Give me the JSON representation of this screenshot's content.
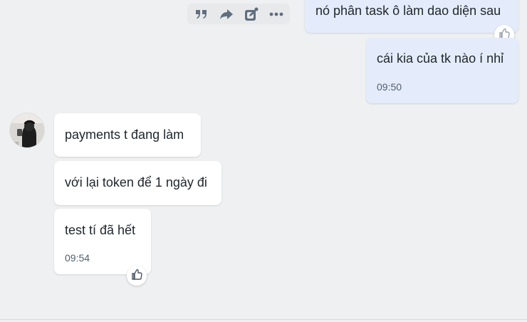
{
  "toolbar": {
    "icons": [
      "quote-icon",
      "forward-icon",
      "edit-icon",
      "more-icon"
    ],
    "icon_color": "#5f6f7f"
  },
  "messages": {
    "sent": [
      {
        "text": "nó phân task ô làm dao diện sau"
      },
      {
        "text": "cái kia của tk nào í nhỉ",
        "time": "09:50"
      }
    ],
    "received": [
      {
        "text": "payments t đang làm"
      },
      {
        "text": "với lại token để 1 ngày đi"
      },
      {
        "text": "test tí đã hết",
        "time": "09:54"
      }
    ]
  },
  "colors": {
    "background": "#eef0f1",
    "sent_bubble": "#e4ecfb",
    "received_bubble": "#ffffff",
    "text": "#1f252c",
    "time": "#516171"
  },
  "icons": {
    "react": "thumbs-up-icon",
    "avatar": "avatar"
  }
}
